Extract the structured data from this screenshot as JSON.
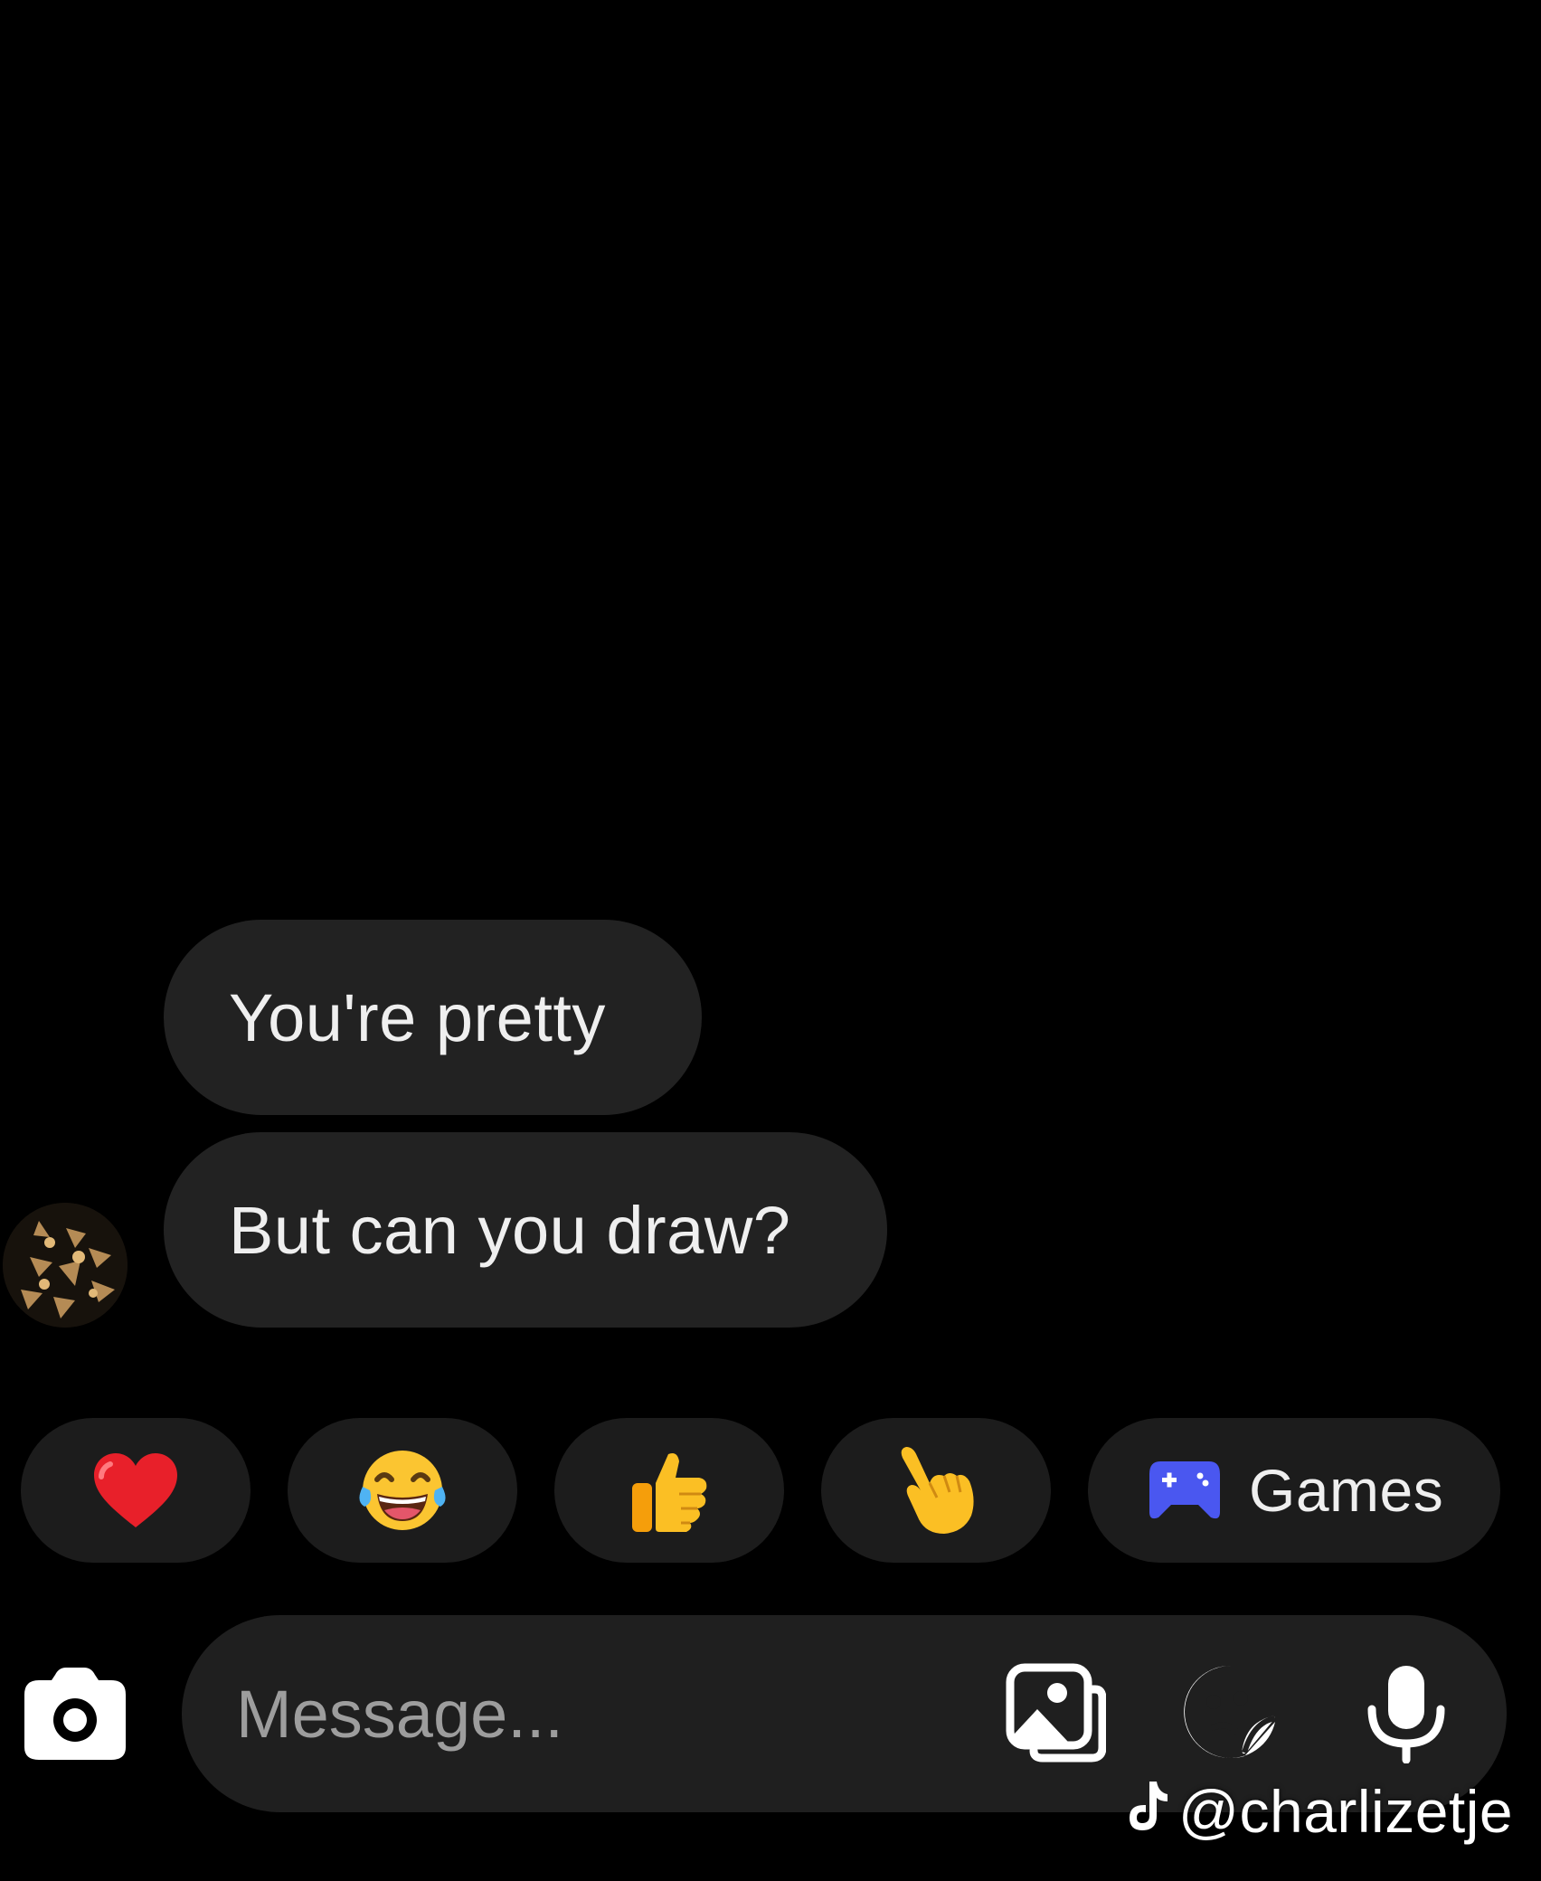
{
  "chat": {
    "messages": [
      {
        "text": "You're pretty"
      },
      {
        "text": "But can you draw?"
      }
    ]
  },
  "quick_reactions": [
    {
      "icon": "red-heart-emoji"
    },
    {
      "icon": "tears-of-joy-emoji"
    },
    {
      "icon": "thumbs-up-emoji"
    },
    {
      "icon": "pointing-hand-emoji"
    },
    {
      "icon": "game-controller-icon",
      "label": "Games"
    }
  ],
  "composer": {
    "placeholder": "Message...",
    "icons": [
      "camera-icon",
      "gallery-icon",
      "sticker-icon",
      "microphone-icon"
    ]
  },
  "watermark": {
    "text": "@charlizetje",
    "icon": "tiktok-logo"
  },
  "colors": {
    "background": "#000000",
    "bubble": "#222222",
    "chip": "#1c1c1c",
    "composer": "#1f1f1f",
    "games_accent": "#4a57f0"
  }
}
